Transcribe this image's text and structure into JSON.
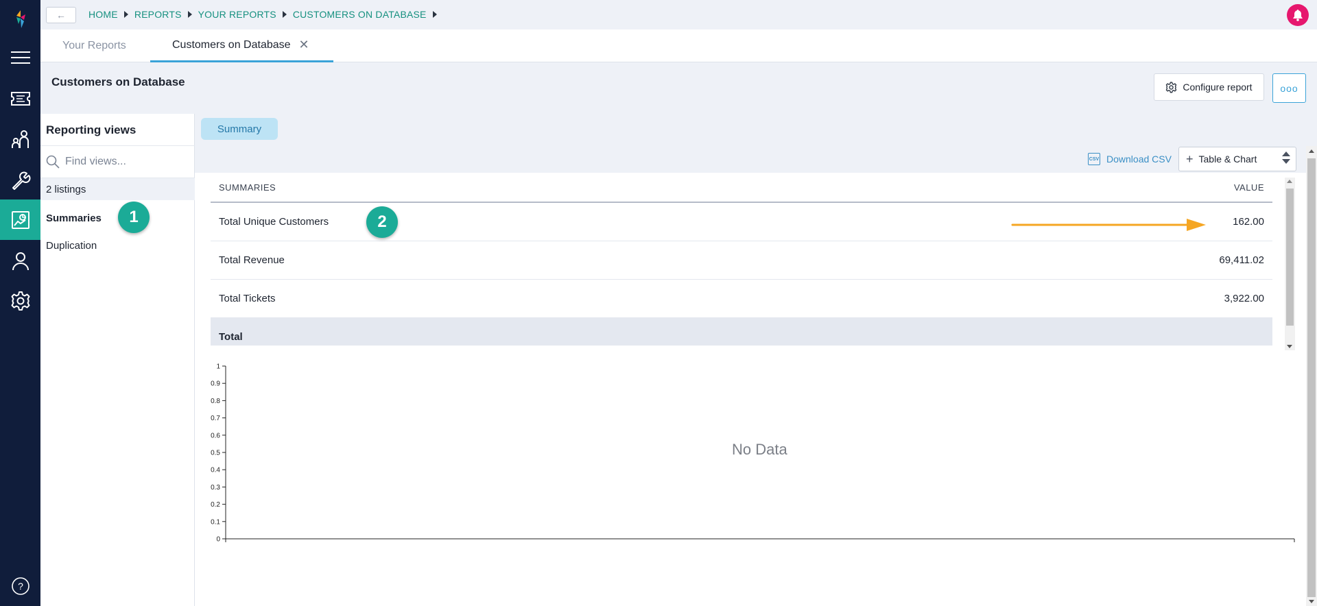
{
  "breadcrumb": [
    "HOME",
    "REPORTS",
    "YOUR REPORTS",
    "CUSTOMERS ON DATABASE"
  ],
  "tabs": [
    {
      "label": "Your Reports",
      "active": false
    },
    {
      "label": "Customers on Database",
      "active": true
    }
  ],
  "page": {
    "title": "Customers on Database",
    "configure_label": "Configure report",
    "more_label": "ooo"
  },
  "views": {
    "title": "Reporting views",
    "search_placeholder": "Find views...",
    "listings": "2 listings",
    "items": [
      "Summaries",
      "Duplication"
    ],
    "selected": "Summaries"
  },
  "view_chip": "Summary",
  "toolbar": {
    "download_label": "Download CSV",
    "csv_icon_text": "CSV",
    "display_mode": "Table & Chart"
  },
  "table": {
    "headers": [
      "SUMMARIES",
      "VALUE"
    ],
    "rows": [
      {
        "label": "Total Unique Customers",
        "value": "162.00"
      },
      {
        "label": "Total Revenue",
        "value": "69,411.02"
      },
      {
        "label": "Total Tickets",
        "value": "3,922.00"
      }
    ],
    "total_label": "Total"
  },
  "annotations": {
    "badge1": "1",
    "badge2": "2"
  },
  "chart_data": {
    "type": "bar",
    "message": "No Data",
    "ylim": [
      0,
      1
    ],
    "yticks": [
      "1",
      "0.9",
      "0.8",
      "0.7",
      "0.6",
      "0.5",
      "0.4",
      "0.3",
      "0.2",
      "0.1",
      "0"
    ],
    "values": []
  },
  "colors": {
    "rail": "#101d3b",
    "accent_teal": "#1bab97",
    "link_blue": "#3a8fc5",
    "bell_pink": "#e6176e",
    "arrow_orange": "#f5a623"
  },
  "icons": {
    "logo": "logo-icon",
    "menu": "hamburger-icon",
    "tickets": "ticket-icon",
    "people": "people-icon",
    "tools": "wrench-icon",
    "reports": "reports-icon",
    "user": "user-icon",
    "settings": "gear-icon",
    "help": "help-icon",
    "bell": "bell-icon"
  }
}
